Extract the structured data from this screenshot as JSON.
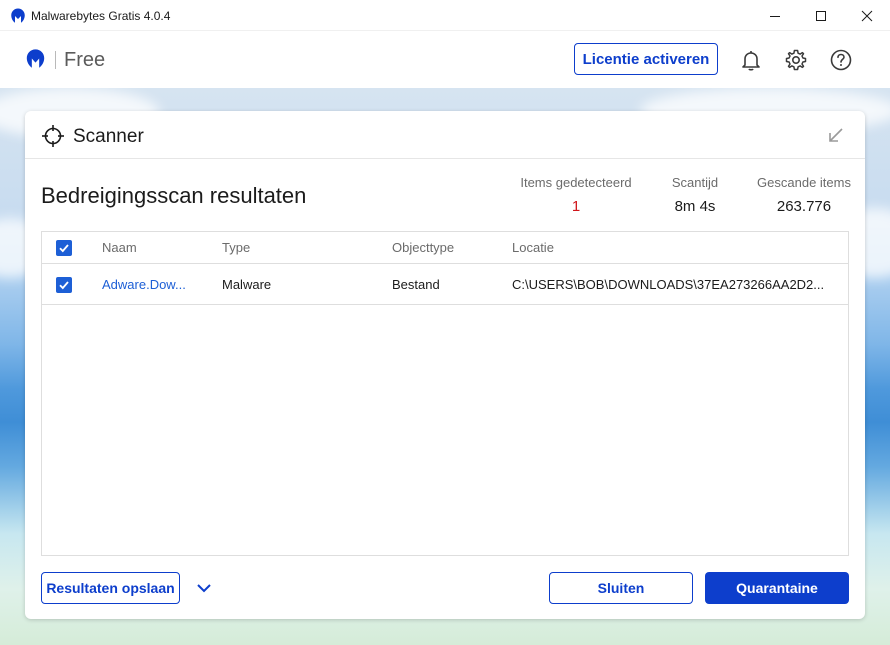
{
  "window": {
    "title": "Malwarebytes Gratis  4.0.4"
  },
  "header": {
    "edition": "Free",
    "license_button": "Licentie activeren"
  },
  "colors": {
    "brand": "#0d3ecc",
    "alert": "#d0161b",
    "link": "#1d5fd6"
  },
  "icons": {
    "app": "malwarebytes-logo-icon",
    "notifications": "bell-icon",
    "settings": "gear-icon",
    "help": "question-icon",
    "scanner": "crosshair-icon",
    "collapse": "arrow-down-left-icon",
    "dropdown": "chevron-down-icon"
  },
  "card": {
    "title": "Scanner",
    "results_title": "Bedreigingsscan resultaten",
    "stats": [
      {
        "label": "Items gedetecteerd",
        "value": "1"
      },
      {
        "label": "Scantijd",
        "value": "8m 4s"
      },
      {
        "label": "Gescande items",
        "value": "263.776"
      }
    ]
  },
  "table": {
    "columns": [
      "Naam",
      "Type",
      "Objecttype",
      "Locatie"
    ],
    "rows": [
      {
        "checked": true,
        "name": "Adware.Dow...",
        "type": "Malware",
        "objecttype": "Bestand",
        "location": "C:\\USERS\\BOB\\DOWNLOADS\\37EA273266AA2D2..."
      }
    ]
  },
  "footer": {
    "save_button": "Resultaten opslaan",
    "close_button": "Sluiten",
    "quarantine_button": "Quarantaine"
  }
}
